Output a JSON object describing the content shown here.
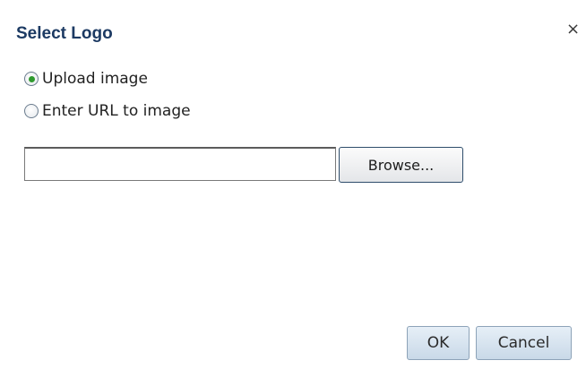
{
  "dialog": {
    "title": "Select Logo",
    "close_glyph": "×"
  },
  "source_options": [
    {
      "label": "Upload image",
      "checked": true
    },
    {
      "label": "Enter URL to image",
      "checked": false
    }
  ],
  "upload": {
    "file_value": "",
    "browse_label": "Browse..."
  },
  "footer": {
    "ok_label": "OK",
    "cancel_label": "Cancel"
  },
  "colors": {
    "title": "#1c3a63",
    "radio_selected": "#2f9a2f",
    "footer_button_bg": "#d6e3ef"
  }
}
